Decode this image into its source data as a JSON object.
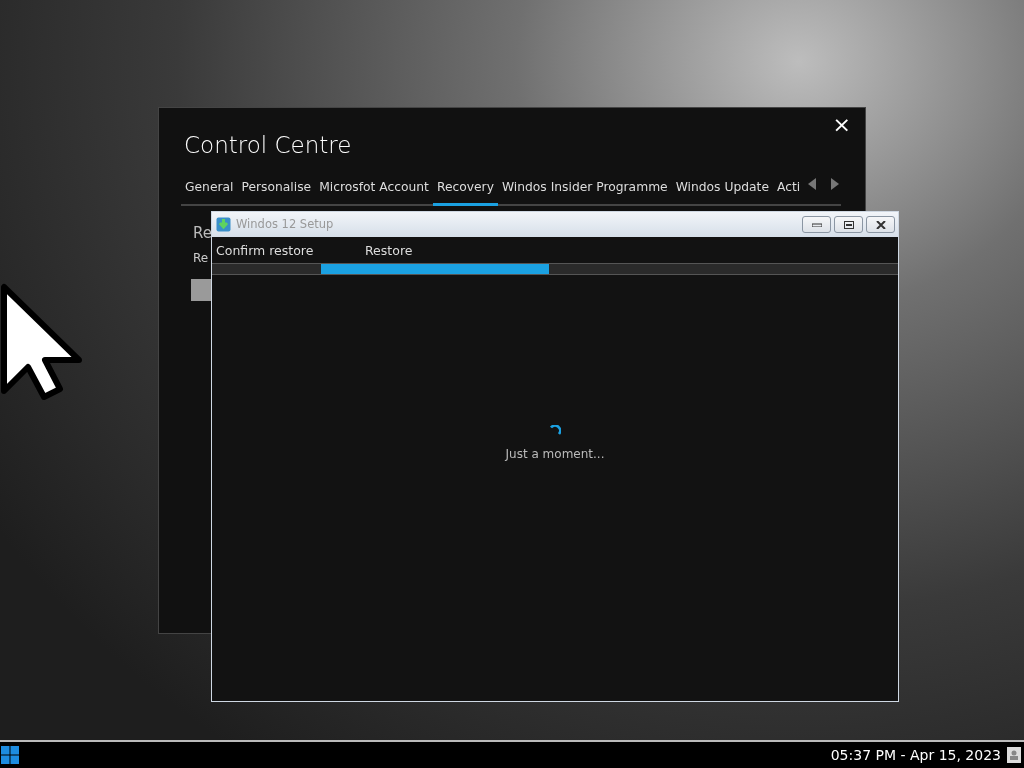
{
  "control_centre": {
    "title": "Control Centre",
    "close": "×",
    "tabs": [
      {
        "label": "General",
        "selected": false
      },
      {
        "label": "Personalise",
        "selected": false
      },
      {
        "label": "Microsfot Account",
        "selected": false
      },
      {
        "label": "Recovery",
        "selected": true
      },
      {
        "label": "Windos Insider Programme",
        "selected": false
      },
      {
        "label": "Windos Update",
        "selected": false
      },
      {
        "label": "Acti",
        "selected": false
      }
    ],
    "section_heading": "Re",
    "section_text": "Re"
  },
  "setup_window": {
    "title": "Windos 12 Setup",
    "steps": [
      {
        "label": "Confirm restore",
        "selected": false
      },
      {
        "label": "Restore",
        "selected": true
      }
    ],
    "status": "Just a moment..."
  },
  "taskbar": {
    "clock": "05:37 PM - Apr 15, 2023"
  }
}
